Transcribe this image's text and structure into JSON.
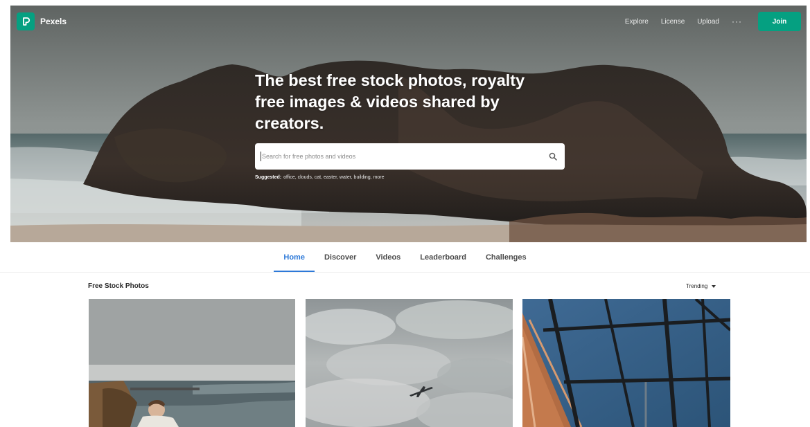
{
  "brand": {
    "name": "Pexels"
  },
  "header": {
    "nav": [
      "Explore",
      "License",
      "Upload"
    ],
    "more": "···",
    "join_label": "Join"
  },
  "hero": {
    "title": "The best free stock photos, royalty free images & videos shared by creators.",
    "search": {
      "placeholder": "Search for free photos and videos"
    },
    "suggested_label": "Suggested:",
    "suggested_terms": "office, clouds, cat, easter, water, building, more"
  },
  "tabs": [
    {
      "label": "Home",
      "active": true
    },
    {
      "label": "Discover",
      "active": false
    },
    {
      "label": "Videos",
      "active": false
    },
    {
      "label": "Leaderboard",
      "active": false
    },
    {
      "label": "Challenges",
      "active": false
    }
  ],
  "section": {
    "title": "Free Stock Photos",
    "sort": "Trending"
  },
  "photos": [
    {
      "subject": "man wrapped in blanket on rocky seashore"
    },
    {
      "subject": "airplane in cloudy sky"
    },
    {
      "subject": "window frame and brick building with tower"
    }
  ],
  "colors": {
    "brand_green": "#05a081",
    "active_tab": "#2d79d8"
  },
  "icons": {
    "logo": "pexels-logo-icon",
    "search": "search-icon",
    "dropdown": "chevron-down-icon"
  }
}
